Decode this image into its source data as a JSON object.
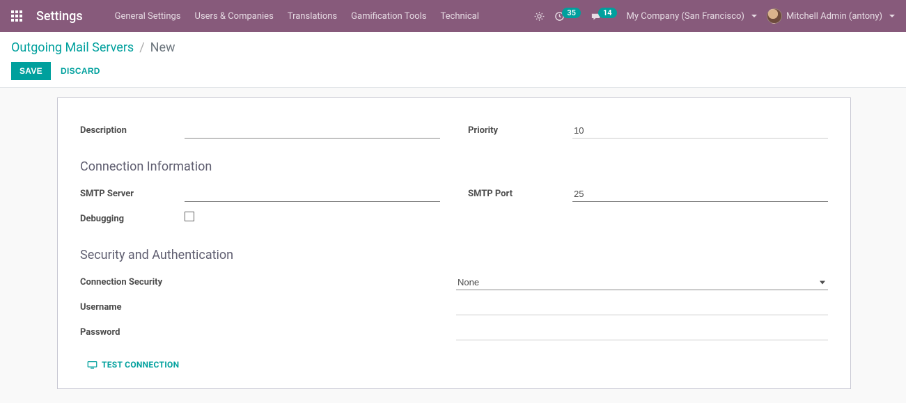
{
  "navbar": {
    "brand": "Settings",
    "menu": [
      "General Settings",
      "Users & Companies",
      "Translations",
      "Gamification Tools",
      "Technical"
    ],
    "counter_activities": "35",
    "counter_discuss": "14",
    "company": "My Company (San Francisco)",
    "user": "Mitchell Admin (antony)"
  },
  "breadcrumb": {
    "parent": "Outgoing Mail Servers",
    "current": "New"
  },
  "buttons": {
    "save": "SAVE",
    "discard": "DISCARD",
    "test_connection": "TEST CONNECTION"
  },
  "fields": {
    "description_label": "Description",
    "description_value": "",
    "priority_label": "Priority",
    "priority_value": "10",
    "section_connection": "Connection Information",
    "smtp_server_label": "SMTP Server",
    "smtp_server_value": "",
    "smtp_port_label": "SMTP Port",
    "smtp_port_value": "25",
    "debugging_label": "Debugging",
    "section_security": "Security and Authentication",
    "conn_security_label": "Connection Security",
    "conn_security_value": "None",
    "username_label": "Username",
    "username_value": "",
    "password_label": "Password",
    "password_value": ""
  }
}
